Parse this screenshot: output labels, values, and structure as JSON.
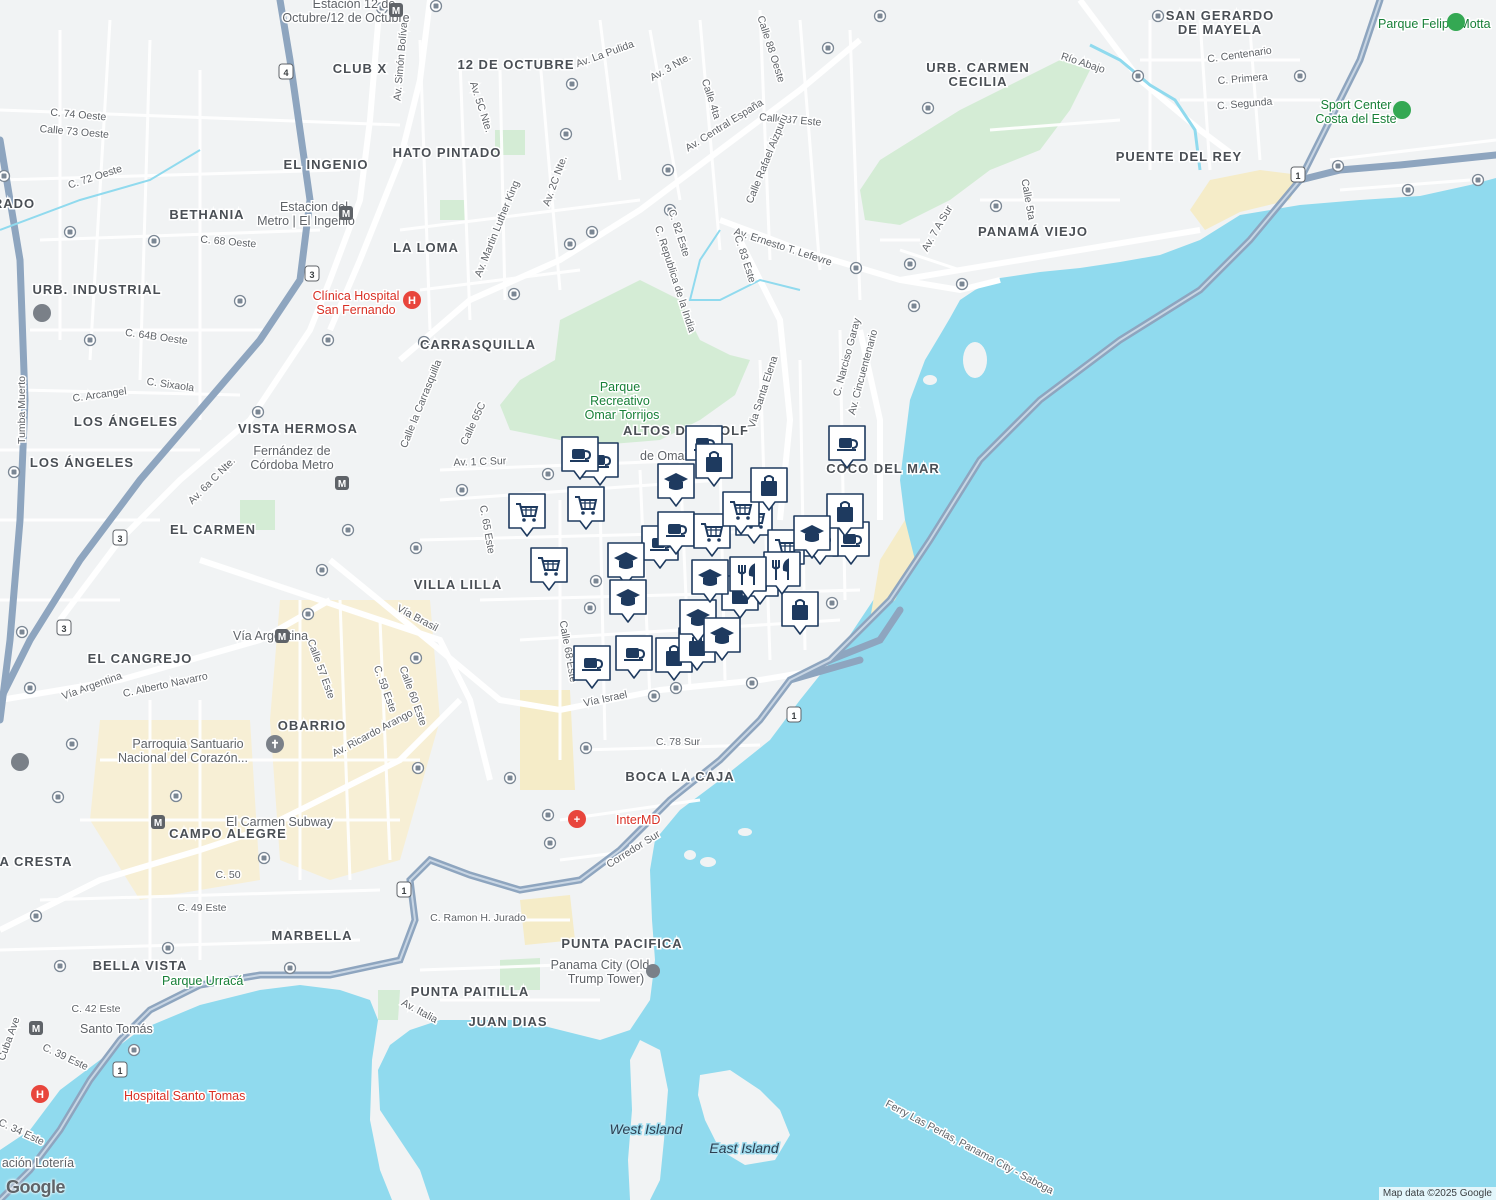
{
  "colors": {
    "water": "#90daee",
    "land": "#f1f3f4",
    "park": "#d4ecd5",
    "highway": "#8ea5bf",
    "road": "#ffffff",
    "marker": "#1e3a5f",
    "sand": "#f5ecc8"
  },
  "map": {
    "neighborhoods": [
      {
        "id": "club-x",
        "text": "CLUB X"
      },
      {
        "id": "hato-pintado",
        "text": "HATO PINTADO"
      },
      {
        "id": "el-ingenio",
        "text": "EL INGENIO"
      },
      {
        "id": "bethania",
        "text": "BETHANIA"
      },
      {
        "id": "la-loma",
        "text": "LA LOMA"
      },
      {
        "id": "urb-industrial",
        "text": "URB. INDUSTRIAL"
      },
      {
        "id": "carrasquilla",
        "text": "CARRASQUILLA"
      },
      {
        "id": "los-angeles-1",
        "text": "LOS ÁNGELES"
      },
      {
        "id": "los-angeles-2",
        "text": "LOS ÁNGELES"
      },
      {
        "id": "vista-hermosa",
        "text": "VISTA HERMOSA"
      },
      {
        "id": "el-carmen",
        "text": "EL CARMEN"
      },
      {
        "id": "villa-lilla",
        "text": "VILLA LILLA"
      },
      {
        "id": "el-cangrejo",
        "text": "EL CANGREJO"
      },
      {
        "id": "obarrio",
        "text": "OBARRIO"
      },
      {
        "id": "campo-alegre",
        "text": "CAMPO ALEGRE"
      },
      {
        "id": "marbella",
        "text": "MARBELLA"
      },
      {
        "id": "bella-vista",
        "text": "BELLA VISTA"
      },
      {
        "id": "punta-paitilla",
        "text": "PUNTA PAITILLA"
      },
      {
        "id": "juan-dias",
        "text": "JUAN DIAS"
      },
      {
        "id": "punta-pacifica",
        "text": "PUNTA PACIFICA"
      },
      {
        "id": "boca-la-caja",
        "text": "BOCA LA CAJA"
      },
      {
        "id": "coco-del-mar",
        "text": "COCO DEL MAR"
      },
      {
        "id": "altos-del-golf",
        "text": "ALTOS DEL GOLF"
      },
      {
        "id": "panama-viejo",
        "text": "PANAMÁ VIEJO"
      },
      {
        "id": "puente-del-rey",
        "text": "PUENTE DEL REY"
      },
      {
        "id": "urb-carmen-cecilia",
        "text": "URB. CARMEN"
      },
      {
        "id": "urb-carmen-cecilia-2",
        "text": "CECILIA"
      },
      {
        "id": "san-gerardo",
        "text": "SAN GERARDO"
      },
      {
        "id": "san-gerardo-2",
        "text": "DE MAYELA"
      },
      {
        "id": "doce-octubre",
        "text": "12 DE OCTUBRE"
      },
      {
        "id": "la-cresta",
        "text": "A CRESTA"
      },
      {
        "id": "rado",
        "text": "RADO"
      }
    ],
    "streets": [
      {
        "id": "s1",
        "text": "Av. Central España"
      },
      {
        "id": "s2",
        "text": "Av. Ernesto T. Lefevre"
      },
      {
        "id": "s3",
        "text": "Vía Israel"
      },
      {
        "id": "s4",
        "text": "Vía Brasil"
      },
      {
        "id": "s5",
        "text": "Vía Argentina"
      },
      {
        "id": "s6",
        "text": "Corredor Sur"
      },
      {
        "id": "s7",
        "text": "Av. Cincuentenario"
      },
      {
        "id": "s8",
        "text": "C. Narciso Garay"
      },
      {
        "id": "s9",
        "text": "Via Santa Elena"
      },
      {
        "id": "s10",
        "text": "C. Republica de la India"
      },
      {
        "id": "s11",
        "text": "Av. Martin Luther King"
      },
      {
        "id": "s12",
        "text": "Calle la Carrasquilla"
      },
      {
        "id": "s13",
        "text": "C. 78 Sur"
      },
      {
        "id": "s14",
        "text": "C. 50"
      },
      {
        "id": "s15",
        "text": "C. 49 Este"
      },
      {
        "id": "s16",
        "text": "C. 42 Este"
      },
      {
        "id": "s17",
        "text": "C. Ramon H. Jurado"
      },
      {
        "id": "s18",
        "text": "Av. Ricardo Arango"
      },
      {
        "id": "s19",
        "text": "C. Alberto Navarro"
      },
      {
        "id": "s20",
        "text": "C. 68 Oeste"
      },
      {
        "id": "s21",
        "text": "C. 74 Oeste"
      },
      {
        "id": "s22",
        "text": "Calle 73 Oeste"
      },
      {
        "id": "s23",
        "text": "C. 72 Oeste"
      },
      {
        "id": "s24",
        "text": "C. 64B Oeste"
      },
      {
        "id": "s25",
        "text": "C. Arcangel"
      },
      {
        "id": "s26",
        "text": "C. Sixaola"
      },
      {
        "id": "s27",
        "text": "Av. 6a C Nte."
      },
      {
        "id": "s28",
        "text": "Av. La Pulida"
      },
      {
        "id": "s29",
        "text": "Av. 3 Nte."
      },
      {
        "id": "s30",
        "text": "Calle 87 Este"
      },
      {
        "id": "s31",
        "text": "Calle Rafael Aizpuru"
      },
      {
        "id": "s32",
        "text": "C. Centenario"
      },
      {
        "id": "s33",
        "text": "C. Primera"
      },
      {
        "id": "s34",
        "text": "C. Segunda"
      },
      {
        "id": "s35",
        "text": "Río Abajo"
      },
      {
        "id": "s36",
        "text": "Tumba Muerto"
      },
      {
        "id": "s37",
        "text": "Av. Italia"
      },
      {
        "id": "s38",
        "text": "Calle 68 Este"
      },
      {
        "id": "s39",
        "text": "C. 65 Este"
      },
      {
        "id": "s40",
        "text": "Calle 65C"
      },
      {
        "id": "s41",
        "text": "Av. 1 C Sur"
      },
      {
        "id": "s42",
        "text": "Calle 57 Este"
      },
      {
        "id": "s43",
        "text": "C. 59 Este"
      },
      {
        "id": "s44",
        "text": "Calle 60 Este"
      },
      {
        "id": "s45",
        "text": "C. 39 Este"
      },
      {
        "id": "s46",
        "text": "C. 34 Este"
      },
      {
        "id": "s47",
        "text": "Cuba Ave"
      },
      {
        "id": "s48",
        "text": "Calle 5ta"
      },
      {
        "id": "s49",
        "text": "Av. 7 A Sur"
      },
      {
        "id": "s50",
        "text": "Av. Simón Bolívar"
      },
      {
        "id": "s51",
        "text": "Av. 2C Nte."
      },
      {
        "id": "s52",
        "text": "Av. 5C Nte."
      },
      {
        "id": "s53",
        "text": "Calle 88 Oeste"
      },
      {
        "id": "s54",
        "text": "Calle 4ta"
      },
      {
        "id": "s55",
        "text": "C. 82 Este"
      },
      {
        "id": "s56",
        "text": "C. 83 Este"
      },
      {
        "id": "s57",
        "text": "Ferry Las Perlas, Panama City - Saboga"
      }
    ],
    "pois": [
      {
        "id": "hosp-sf",
        "text": "Clínica Hospital",
        "kind": "red"
      },
      {
        "id": "hosp-sf-2",
        "text": "San Fernando",
        "kind": "red"
      },
      {
        "id": "intermd",
        "text": "InterMD",
        "kind": "red"
      },
      {
        "id": "hosp-st",
        "text": "Hospital Santo Tomas",
        "kind": "red"
      },
      {
        "id": "parque-ot",
        "text": "Parque",
        "kind": "park"
      },
      {
        "id": "parque-ot-2",
        "text": "Recreativo",
        "kind": "park"
      },
      {
        "id": "parque-ot-3",
        "text": "Omar Torrijos",
        "kind": "park"
      },
      {
        "id": "parque-fm",
        "text": "Parque Felipe Motta",
        "kind": "park"
      },
      {
        "id": "sport",
        "text": "Sport Center",
        "kind": "park"
      },
      {
        "id": "sport-2",
        "text": "Costa del Este",
        "kind": "park"
      },
      {
        "id": "urraca",
        "text": "Parque Urracá",
        "kind": "park"
      },
      {
        "id": "parroquia",
        "text": "Parroquia Santuario",
        "kind": "grey"
      },
      {
        "id": "parroquia-2",
        "text": "Nacional del Corazón...",
        "kind": "grey"
      },
      {
        "id": "trump",
        "text": "Panama City (Old",
        "kind": "grey"
      },
      {
        "id": "trump-2",
        "text": "Trump Tower)",
        "kind": "grey"
      },
      {
        "id": "via-arg-metro",
        "text": "Vía Argentina",
        "kind": "grey"
      },
      {
        "id": "carmen-subway",
        "text": "El Carmen Subway",
        "kind": "grey"
      },
      {
        "id": "santo-tomas",
        "text": "Santo Tomás",
        "kind": "grey"
      },
      {
        "id": "fernandez",
        "text": "Fernández de",
        "kind": "grey"
      },
      {
        "id": "fernandez-2",
        "text": "Córdoba Metro",
        "kind": "grey"
      },
      {
        "id": "est-ingenio",
        "text": "Estacion del",
        "kind": "grey"
      },
      {
        "id": "est-ingenio-2",
        "text": "Metro | El Ingenio",
        "kind": "grey"
      },
      {
        "id": "est-12oct",
        "text": "Estación 12 de",
        "kind": "grey"
      },
      {
        "id": "est-12oct-2",
        "text": "Octubre/12 de Octubre",
        "kind": "grey"
      },
      {
        "id": "loteria",
        "text": "ación Lotería",
        "kind": "grey"
      },
      {
        "id": "de-omar",
        "text": "de Omar",
        "kind": "grey"
      }
    ],
    "islands": [
      {
        "id": "west",
        "text": "West Island"
      },
      {
        "id": "east",
        "text": "East Island"
      }
    ],
    "markers": [
      {
        "type": "coffee"
      },
      {
        "type": "coffee"
      },
      {
        "type": "coffee"
      },
      {
        "type": "coffee"
      },
      {
        "type": "coffee"
      },
      {
        "type": "coffee"
      },
      {
        "type": "coffee"
      },
      {
        "type": "coffee"
      },
      {
        "type": "coffee"
      },
      {
        "type": "coffee"
      },
      {
        "type": "cart"
      },
      {
        "type": "cart"
      },
      {
        "type": "cart"
      },
      {
        "type": "cart"
      },
      {
        "type": "cart"
      },
      {
        "type": "cart"
      },
      {
        "type": "cart"
      },
      {
        "type": "bag"
      },
      {
        "type": "bag"
      },
      {
        "type": "bag"
      },
      {
        "type": "bag"
      },
      {
        "type": "bag"
      },
      {
        "type": "bag"
      },
      {
        "type": "bag"
      },
      {
        "type": "school"
      },
      {
        "type": "school"
      },
      {
        "type": "school"
      },
      {
        "type": "school"
      },
      {
        "type": "school"
      },
      {
        "type": "school"
      },
      {
        "type": "school"
      },
      {
        "type": "restaurant"
      },
      {
        "type": "restaurant"
      },
      {
        "type": "restaurant"
      }
    ],
    "route_shields": [
      "4",
      "3",
      "3",
      "3",
      "1",
      "1",
      "1",
      "1"
    ]
  },
  "attribution": "Map data ©2025 Google",
  "logo": "Google"
}
